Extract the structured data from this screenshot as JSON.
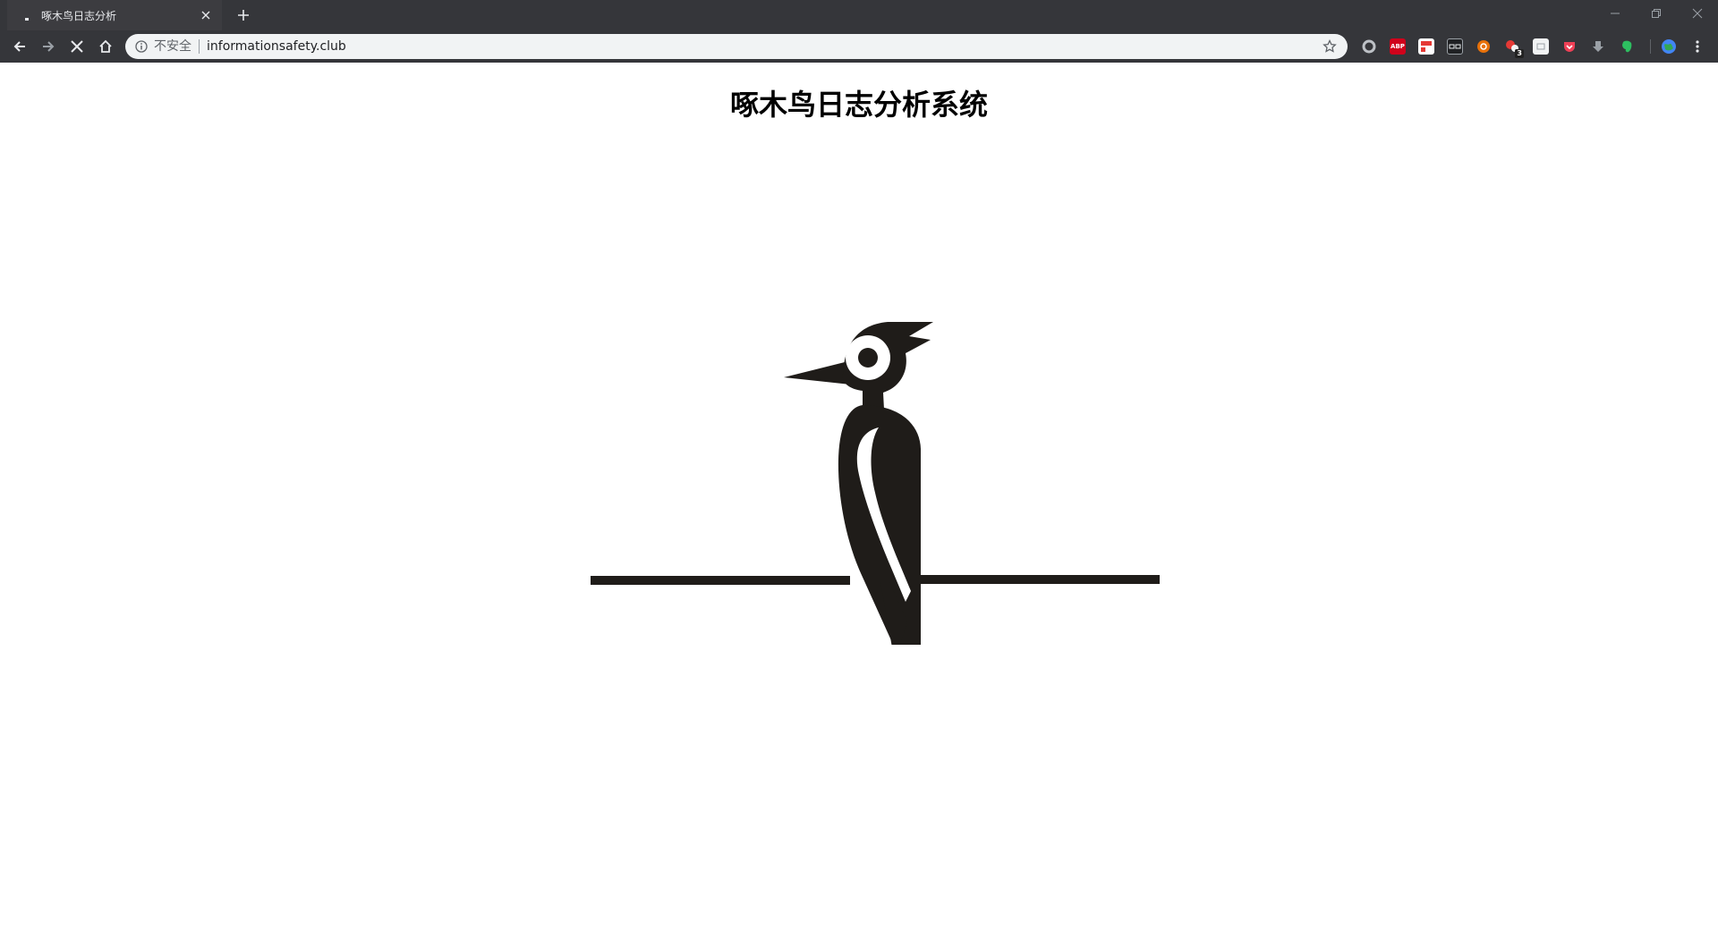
{
  "browser": {
    "tab": {
      "title": "啄木鸟日志分析",
      "close_icon": "close-icon"
    },
    "new_tab_icon": "plus-icon",
    "window_controls": [
      "minimize-icon",
      "restore-icon",
      "close-icon"
    ],
    "nav": {
      "back_icon": "arrow-left-icon",
      "forward_icon": "arrow-right-icon",
      "stop_icon": "close-icon",
      "home_icon": "home-icon"
    },
    "omnibox": {
      "security_label": "不安全",
      "url": "informationsafety.club",
      "bookmark_icon": "star-icon"
    },
    "extensions": [
      {
        "name": "circle-extension-icon",
        "color": "#bdc1c6"
      },
      {
        "name": "adblock-plus-icon",
        "label": "ABP",
        "color": "#d0021b"
      },
      {
        "name": "red-extension-icon",
        "color": "#e53935"
      },
      {
        "name": "glasses-extension-icon",
        "color": "#5f6368"
      },
      {
        "name": "orange-extension-icon",
        "color": "#e8710a"
      },
      {
        "name": "badge-extension-icon",
        "badge": "3",
        "color": "#e53935"
      },
      {
        "name": "white-extension-icon",
        "color": "#f1f3f4"
      },
      {
        "name": "pocket-icon",
        "color": "#ef4056"
      },
      {
        "name": "download-extension-icon",
        "color": "#9aa0a6"
      },
      {
        "name": "evernote-icon",
        "color": "#2dbe60"
      },
      {
        "name": "profile-avatar-icon",
        "color": "#4285f4"
      },
      {
        "name": "menu-kebab-icon",
        "color": "#e8eaed"
      }
    ]
  },
  "page": {
    "title": "啄木鸟日志分析系统",
    "logo_icon": "woodpecker-logo-icon",
    "logo_color": "#1f1c19"
  }
}
